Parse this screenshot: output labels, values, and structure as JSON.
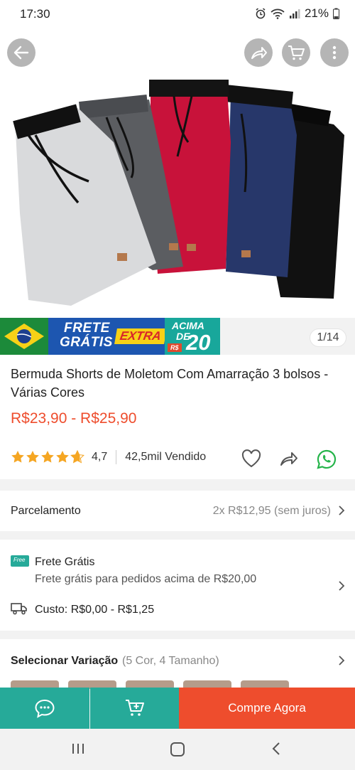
{
  "status": {
    "time": "17:30",
    "battery": "21%"
  },
  "banner": {
    "frete": "FRETE",
    "gratis": "GRÁTIS",
    "extra": "EXTRA",
    "acima": "ACIMA",
    "de": "DE",
    "amount": "20",
    "rs": "R$"
  },
  "gallery": {
    "counter": "1/14"
  },
  "product": {
    "title": "Bermuda Shorts de Moletom Com Amarração 3 bolsos - Várias Cores",
    "price": "R$23,90 - R$25,90",
    "rating": "4,7",
    "rating_fraction": 0.94,
    "sold": "42,5mil Vendido"
  },
  "installments": {
    "label": "Parcelamento",
    "value": "2x R$12,95 (sem juros)"
  },
  "shipping": {
    "badge": "Free",
    "title": "Frete Grátis",
    "subtitle": "Frete grátis para pedidos acima de R$20,00",
    "cost": "Custo: R$0,00 - R$1,25"
  },
  "variation": {
    "label": "Selecionar Variação",
    "detail": "(5 Cor, 4 Tamanho)"
  },
  "bottom": {
    "buy": "Compre Agora"
  },
  "colors": {
    "accent": "#ee4d2d",
    "teal": "#26aa99",
    "star": "#f5a623"
  }
}
